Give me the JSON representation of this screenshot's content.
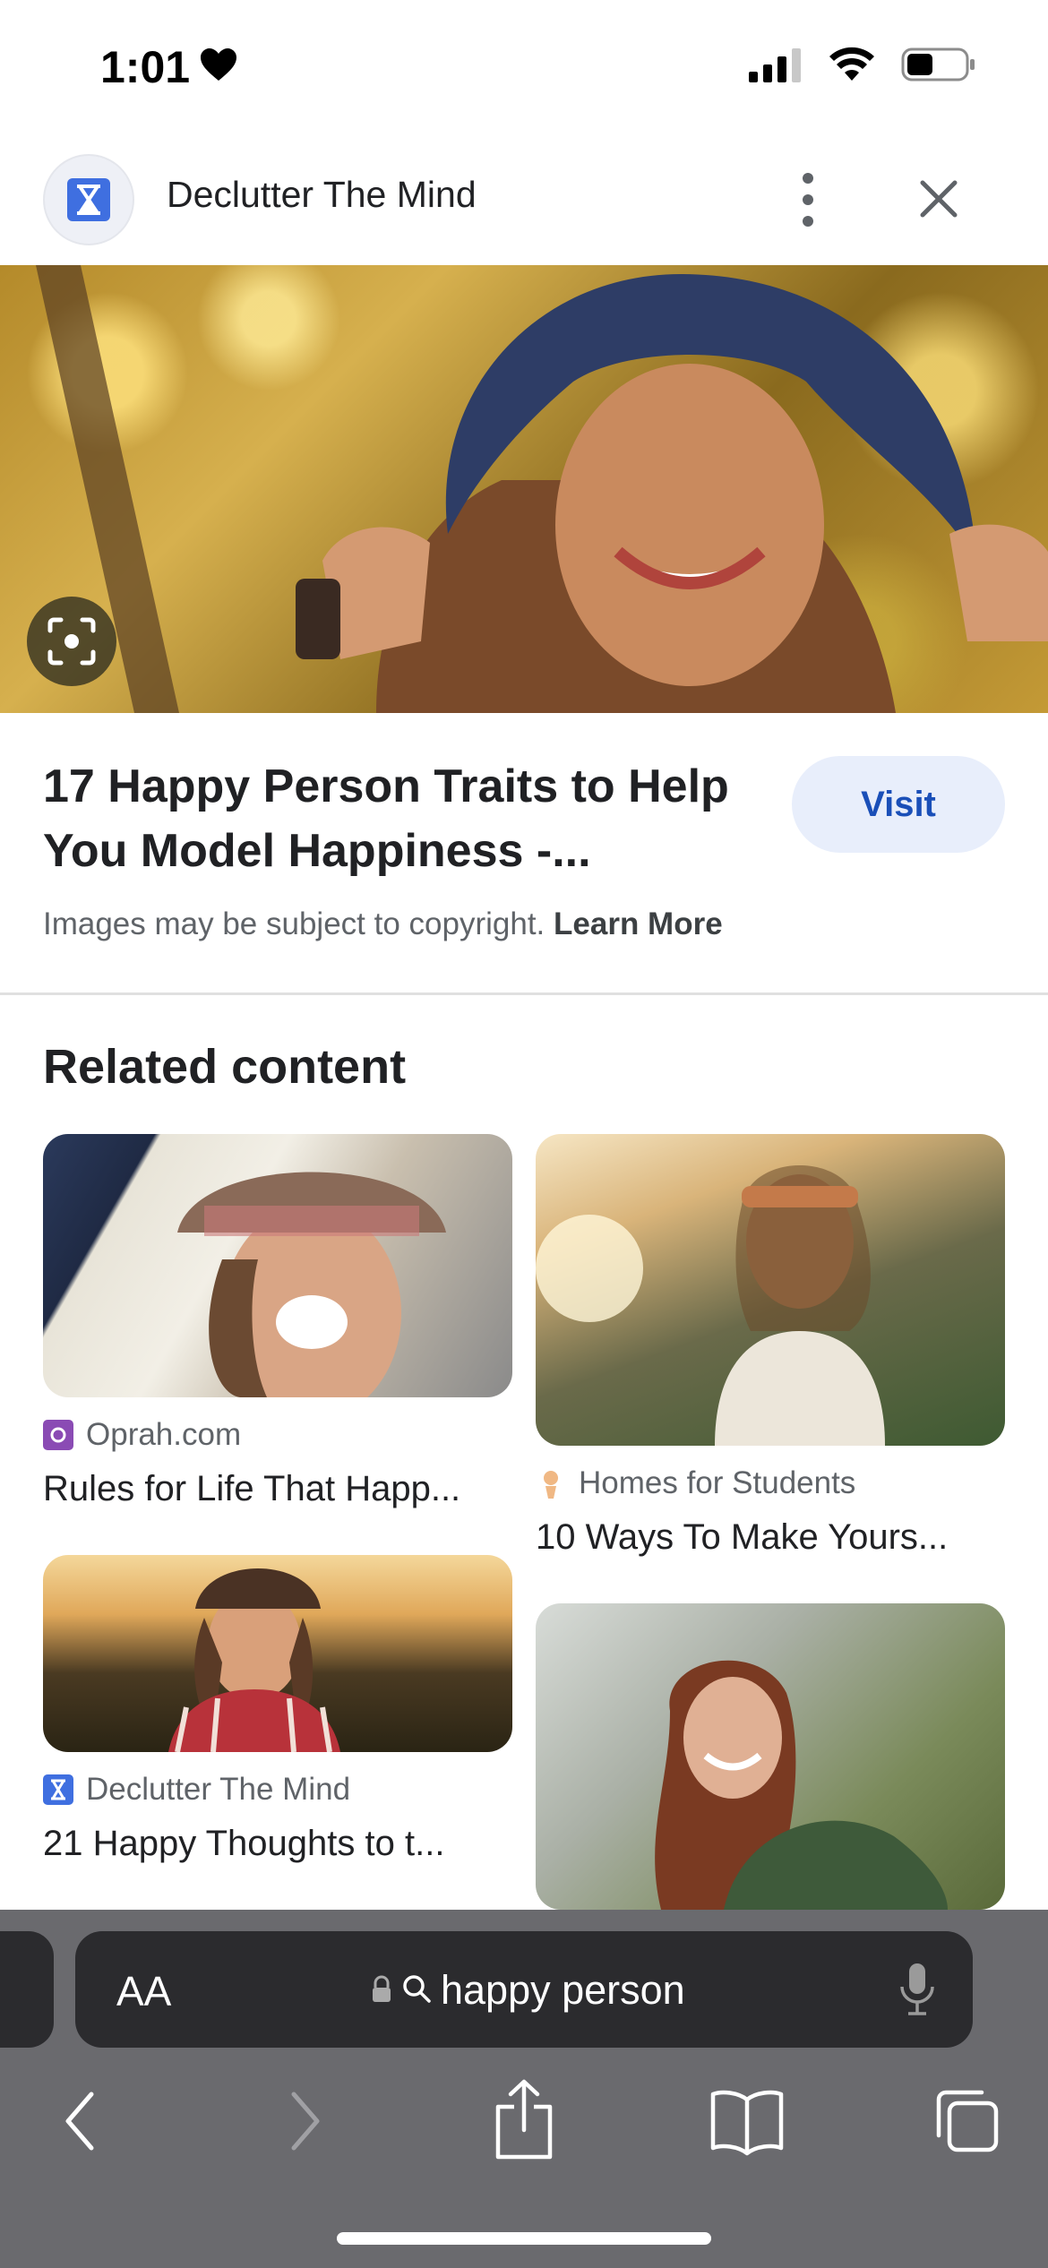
{
  "status_bar": {
    "time": "1:01"
  },
  "header": {
    "site_name": "Declutter The Mind"
  },
  "result": {
    "title_line1": "17 Happy Person Traits to Help",
    "title_line2": "You Model Happiness -...",
    "visit_label": "Visit",
    "copyright_text": "Images may be subject to copyright.",
    "learn_more": "Learn More"
  },
  "related": {
    "heading": "Related content",
    "cards": [
      {
        "source": "Oprah.com",
        "title": "Rules for Life That Happ..."
      },
      {
        "source": "Homes for Students",
        "title": "10 Ways To Make Yours..."
      },
      {
        "source": "Declutter The Mind",
        "title": "21 Happy Thoughts to t..."
      }
    ]
  },
  "browser": {
    "text_size_label": "AA",
    "url_text": "happy person"
  },
  "colors": {
    "accent": "#1a4fb8",
    "visit_bg": "#e8eefb",
    "toolbar_bg": "#6a6a6e",
    "urlbar_bg": "#2b2b2e"
  },
  "icons": [
    "heart-icon",
    "signal-icon",
    "wifi-icon",
    "battery-icon",
    "more-vert-icon",
    "close-icon",
    "lens-icon",
    "lock-icon",
    "search-icon",
    "mic-icon",
    "back-icon",
    "forward-icon",
    "share-icon",
    "bookmarks-icon",
    "tabs-icon"
  ]
}
